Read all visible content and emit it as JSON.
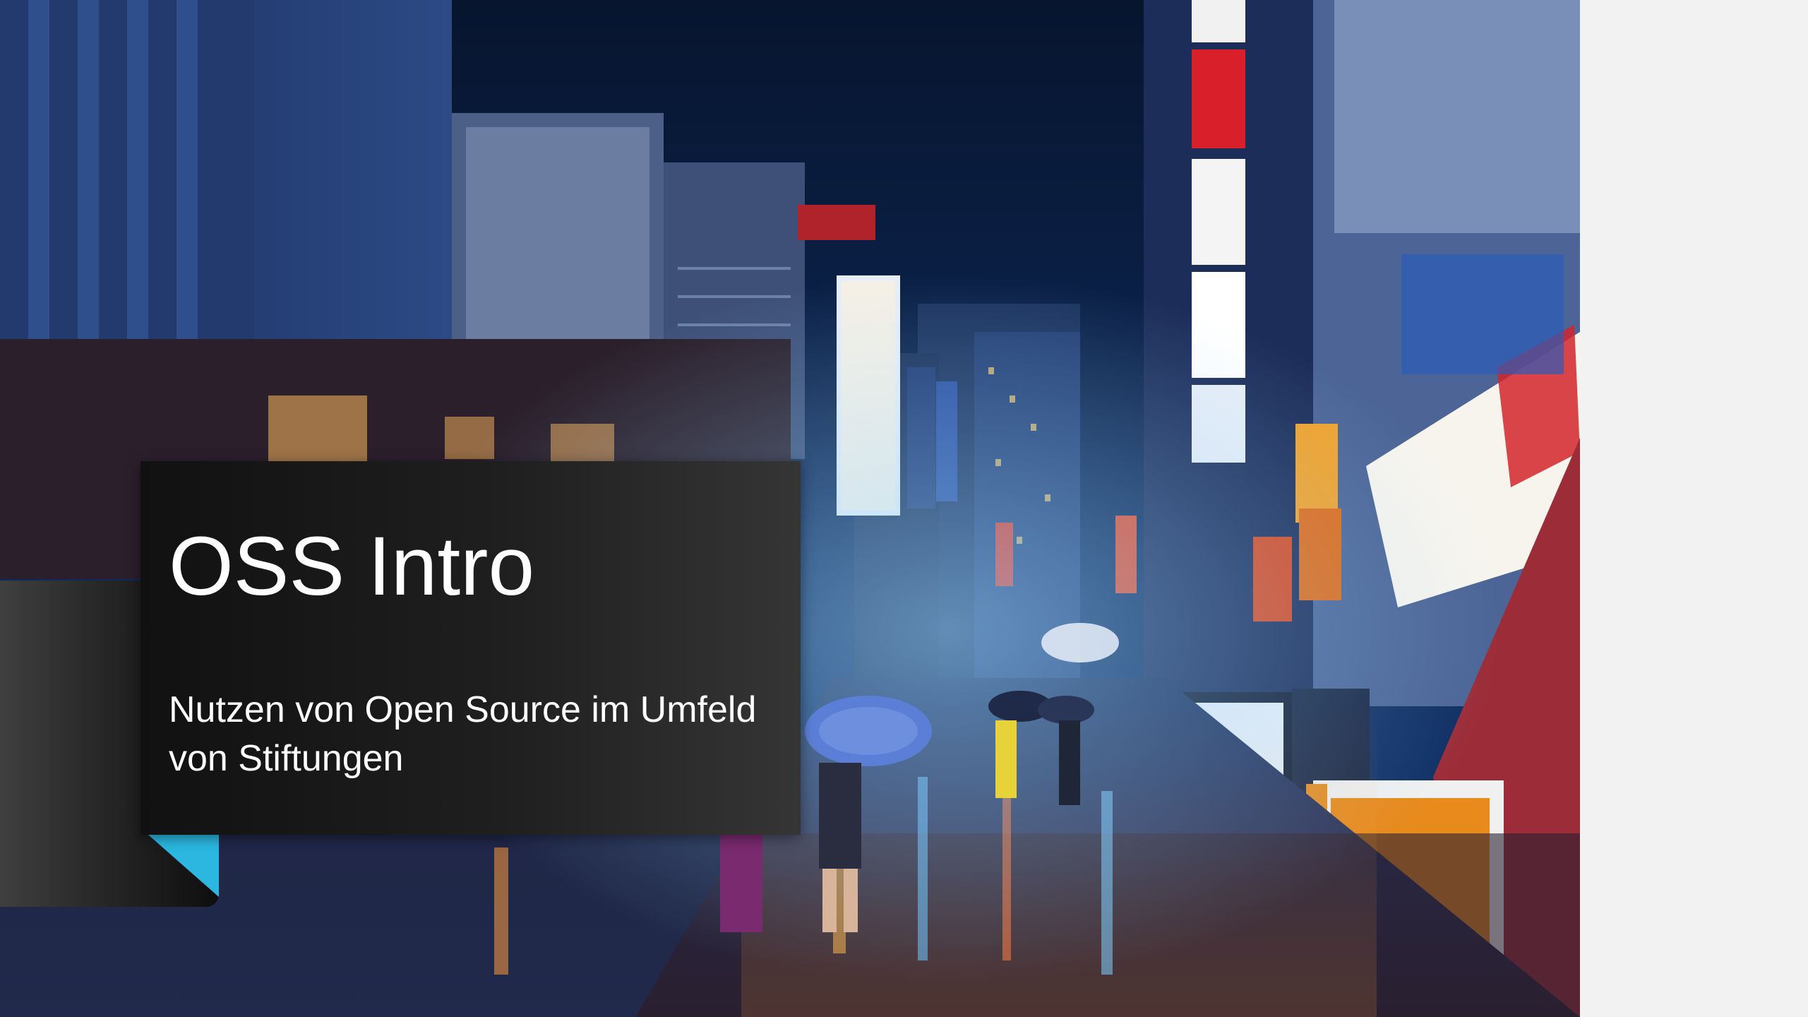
{
  "slide": {
    "title": "OSS Intro",
    "subtitle": "Nutzen von Open Source im Umfeld von Stiftungen"
  },
  "colors": {
    "accent": "#2bb7e0",
    "title_box": "#1f1f1f",
    "text": "#ffffff",
    "background": "#f2f2f2"
  },
  "icons": {
    "accent_shape": "triangle-accent"
  }
}
